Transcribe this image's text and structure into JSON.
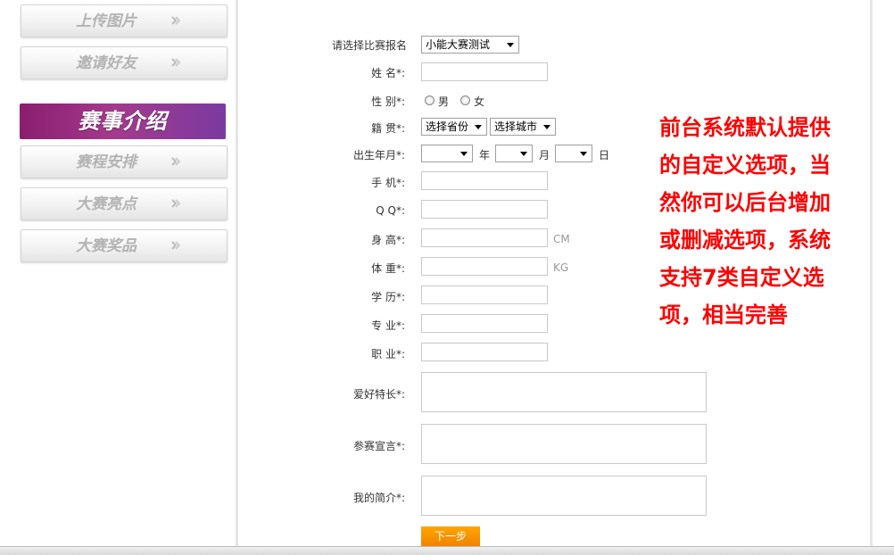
{
  "sidebar": {
    "upload_label": "上传图片",
    "invite_label": "邀请好友",
    "section_title": "赛事介绍",
    "schedule_label": "赛程安排",
    "highlights_label": "大赛亮点",
    "prizes_label": "大赛奖品"
  },
  "form": {
    "contest_label": "请选择比赛报名",
    "contest_value": "小能大赛测试",
    "name_label": "姓  名*:",
    "gender_label": "性  别*:",
    "gender_male": "男",
    "gender_female": "女",
    "hometown_label": "籍  贯*:",
    "province_value": "选择省份",
    "city_value": "选择城市",
    "birth_label": "出生年月*:",
    "year_text": "年",
    "month_text": "月",
    "day_text": "日",
    "phone_label": "手  机*:",
    "qq_label": "Q  Q*:",
    "height_label": "身  高*:",
    "height_unit": "CM",
    "weight_label": "体  重*:",
    "weight_unit": "KG",
    "education_label": "学  历*:",
    "major_label": "专  业*:",
    "job_label": "职  业*:",
    "hobby_label": "爱好特长*:",
    "declaration_label": "参赛宣言*:",
    "intro_label": "我的简介*:",
    "next_button": "下一步"
  },
  "annotation": "前台系统默认提供的自定义选项，当然你可以后台增加或删减选项，系统支持7类自定义选项，相当完善",
  "colors": {
    "banner": "#9a2b80",
    "note": "#ff0000",
    "button": "#f39200"
  }
}
